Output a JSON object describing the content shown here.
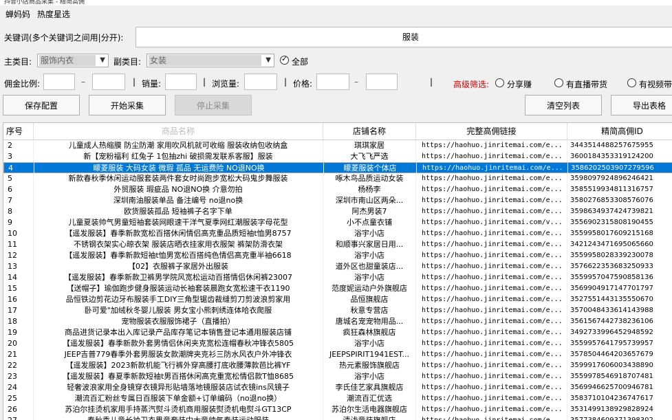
{
  "window": {
    "title": "抖音小店商品采集 - 精简高佣"
  },
  "tabs": [
    {
      "label": "蝉妈妈"
    },
    {
      "label": "热度星选"
    }
  ],
  "form": {
    "keyword_label": "关键词(多个关键词之间用|分开):",
    "keyword_value": "服装",
    "main_category_label": "主类目:",
    "main_category_value": "服饰内衣",
    "sub_category_label": "副类目:",
    "sub_category_value": "女装",
    "all_label": "全部",
    "commission_label": "佣金比例:",
    "dash1": "–",
    "sales_label": "销量:",
    "views_label": "浏览量:",
    "price_label": "价格:",
    "dash2": "–",
    "separator": "|",
    "advanced_label": "高级筛选:",
    "opt_share": "分享赚",
    "opt_live": "有直播带货",
    "opt_video": "有视频带"
  },
  "buttons": {
    "save_config": "保存配置",
    "start_collect": "开始采集",
    "stop_collect": "停止采集",
    "clear_list": "清空列表",
    "export_table": "导出表格"
  },
  "table": {
    "headers": [
      "序号",
      "商品名称",
      "店铺名称",
      "完整高佣链接",
      "精简高佣ID"
    ],
    "selected_index": 2,
    "rows": [
      [
        "2",
        "儿童成人热缩膜 防尘防潮 家用吹风机就可收缩 服装收纳包收纳盒",
        "琪琪家居",
        "https://haohuo.jinritemai.com/e...",
        "3443514488257675955"
      ],
      [
        "3",
        "新【宠粉福利 红兔子 1包抽zhi 破损需发联系客服】服装",
        "大飞飞严选",
        "https://haohuo.jinritemai.com/e...",
        "3600184353319124200"
      ],
      [
        "4",
        "矇菱服装 大码女装  微瑕 孤品 无运费险 NO退NO换",
        "矇菱服装个体店",
        "https://haohuo.jinritemai.com/e...",
        "3586202503907279596"
      ],
      [
        "5",
        "新款春秋季休闲运动服套装两件套女时尚跑步宽松大码鬼步舞服装",
        "啄木鸟品质运动女装",
        "https://haohuo.jinritemai.com/e...",
        "3598097924896246421"
      ],
      [
        "6",
        "外贸服装 瑕疵品 NO退NO换 介意勿拍",
        "杨杨李",
        "https://haohuo.jinritemai.com/e...",
        "3585519934811316757"
      ],
      [
        "7",
        "深圳南油服装单品 备注编号 no退no换",
        "深圳市南山区两朵...",
        "https://haohuo.jinritemai.com/e...",
        "3580276853308576076"
      ],
      [
        "8",
        "欧货服装孤品 短袖裤子名字下单",
        "阿杰男装7",
        "https://haohuo.jinritemai.com/e...",
        "3598634937424739821"
      ],
      [
        "9",
        "儿童夏装帅气男童短袖套装网眼速干洋气夏季网红潮服装字母花型",
        "小不点童衣铺",
        "https://haohuo.jinritemai.com/v...",
        "3556902315808190455"
      ],
      [
        "10",
        "【遥发服装】春季新款宽松百搭休闲情侣高克重品质短袖t恤男8757",
        "浴宇小店",
        "https://haohuo.jinritemai.com/e...",
        "3559958017609215168"
      ],
      [
        "11",
        "不锈钢衣架实心晾衣架 服装店晒衣挂家用衣服架 裤架防滑衣架",
        "和顺事兴家居日用...",
        "https://haohuo.jinritemai.com/e...",
        "3421243471695065660"
      ],
      [
        "12",
        "【遥发服装】春季新款短袖t恤男宽松百搭纯色情侣高克重半袖6618",
        "浴宇小店",
        "https://haohuo.jinritemai.com/e...",
        "3559958028339230078"
      ],
      [
        "13",
        "【02】衣服裤子家居外出服装",
        "道外区也甜童装店...",
        "https://haohuo.jinritemai.com/e...",
        "3576622353683250933"
      ],
      [
        "14",
        "【遥发服装】春季新款卫裤男学院风宽松运动百搭情侣休闲裤23007",
        "浴宇小店",
        "https://haohuo.jinritemai.com/e...",
        "3559957047590858136"
      ],
      [
        "15",
        "【送帽子】瑜伽跑步健身服装运动长袖套装晨跑女宽松速干衣1190",
        "范度妮运动户外旗舰店",
        "https://haohuo.jinritemai.com/e...",
        "3569904917147701797"
      ],
      [
        "16",
        "品恒铁边剪花边牙布服装手工DIY三角型锯齿裁缝剪刀剪波浪剪家用",
        "品恒旗舰店",
        "https://haohuo.jinritemai.com/e...",
        "3527551443135550670"
      ],
      [
        "17",
        "卧可爱\"加绒秋冬婴儿服装 男女宝小熊刺绣连体哈衣爬服",
        "秋意专营店",
        "https://haohuo.jinritemai.com/e...",
        "3570048433614143988"
      ],
      [
        "18",
        "宠物服装衣服服饰裙子（直播拍）",
        "唐城名宠宠物用品...",
        "https://haohuo.jinritemai.com/e...",
        "3561567442738236106"
      ],
      [
        "19",
        "商品进货记录本出入库记录产品库存笔记本销售登记本通用服装店铺",
        "疯狂森林旗舰店",
        "https://haohuo.jinritemai.com/e...",
        "3492733996452948592"
      ],
      [
        "20",
        "【遥发服装】春季新款外套男情侣休闲夹克宽松连帽春秋冲锋衣5805",
        "浴宇小店",
        "https://haohuo.jinritemai.com/e...",
        "3559957641795739957"
      ],
      [
        "21",
        "JEEP吉普779春季外套男服装女款潮牌夹克衫三防水风衣户外冲锋衣",
        "JEEPSPIRIT1941EST...",
        "https://haohuo.jinritemai.com/e...",
        "3578504464203657679"
      ],
      [
        "22",
        "【遥发服装】2023新款机能飞行裤外穿高腰打底收腰薄款芭比裤YF",
        "热元素服饰旗舰店",
        "https://haohuo.jinritemai.com/e...",
        "3599917606003438890"
      ],
      [
        "23",
        "【遥发服装】春夏季新款短袖t男百搭休闲高克重宽松情侣款T恤8685",
        "浴宇小店",
        "https://haohuo.jinritemai.com/e...",
        "3559978546918707481"
      ],
      [
        "24",
        "轻奢波浪家用全身镜穿衣镜异形贴墙落地镜服装店试衣镜ins风镜子",
        "李氏佳艺家具旗舰店",
        "https://haohuo.jinritemai.com/e...",
        "3569946625700946781"
      ],
      [
        "25",
        "潮流百汇粉丝专属日百服装下单金额+订单编码（no退no换）",
        "潮流百汇优选",
        "https://haohuo.jinritemai.com/e...",
        "3583710104236747617"
      ],
      [
        "26",
        "苏泊尔挂烫机家用手持蒸汽熨斗烫机商用服装熨烫机电熨斗GT13CP",
        "苏泊尔生活电器旗舰店",
        "https://haohuo.jinritemai.com/e...",
        "3531499138929828924"
      ],
      [
        "27",
        "春秋季儿童长袖卫衣男童套装中大童帅气春装运动服装",
        "清浅童装旗舰店",
        "https://haohuo.jinritemai.com/e...",
        "3577384609371398302"
      ]
    ]
  }
}
